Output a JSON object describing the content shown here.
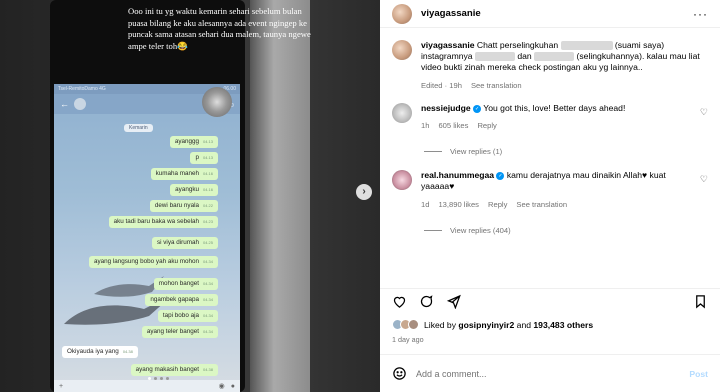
{
  "media": {
    "caption": "Ooo ini tu yg waktu kemarin sehari sebelum bulan puasa bilang ke aku alesannya ada event ngingep ke puncak sama atasan sehari dua malem, taunya ngewe ampe teler toh😂",
    "status_left": "Tsel-RemitoDamo 4G",
    "status_time": "06.00",
    "date_chip": "Kemarin",
    "messages": [
      {
        "text": "ayanggg",
        "time": "04.13",
        "side": "out"
      },
      {
        "text": "p",
        "time": "04.13",
        "side": "out"
      },
      {
        "text": "kumaha maneh",
        "time": "04.16",
        "side": "out"
      },
      {
        "text": "ayangku",
        "time": "04.16",
        "side": "out"
      },
      {
        "text": "dewi baru nyala",
        "time": "04.22",
        "side": "out"
      },
      {
        "text": "aku tadi baru baka wa sebelah",
        "time": "04.23",
        "side": "out"
      },
      {
        "text": "si viya dirumah",
        "time": "04.25",
        "side": "out"
      },
      {
        "text": "ayang langsung bobo yah aku mohon",
        "time": "04.34",
        "side": "out"
      },
      {
        "text": "mohon banget",
        "time": "04.34",
        "side": "out"
      },
      {
        "text": "ngambek gapapa",
        "time": "04.34",
        "side": "out"
      },
      {
        "text": "tapi bobo aja",
        "time": "04.34",
        "side": "out"
      },
      {
        "text": "ayang teler banget",
        "time": "04.34",
        "side": "out"
      },
      {
        "text": "Okiyauda iya yang",
        "time": "04.38",
        "side": "in"
      },
      {
        "text": "ayang makasih banget",
        "time": "04.38",
        "side": "out"
      }
    ]
  },
  "post": {
    "username": "viyagassanie",
    "caption_user": "viyagassanie",
    "caption_text": "Chatt perselingkuhan",
    "caption_suami": "(suami saya)",
    "caption_ig": "instagramnya",
    "caption_dan": "dan",
    "caption_selingkuh": "(selingkuhannya).",
    "caption_rest": "kalau mau liat video bukti zinah mereka check postingan aku yg lainnya..",
    "caption_meta_time": "Edited · 19h",
    "see_translation": "See translation",
    "comments": [
      {
        "user": "nessiejudge",
        "text": "You got this, love! Better days ahead!",
        "time": "1h",
        "likes": "605 likes",
        "reply": "Reply",
        "view_replies": "View replies (1)"
      },
      {
        "user": "real.hanummegaa",
        "text": "kamu derajatnya mau dinaikin Allah♥ kuat yaaaaa♥",
        "time": "1d",
        "likes": "13,890 likes",
        "reply": "Reply",
        "see_translation": "See translation",
        "view_replies": "View replies (404)"
      }
    ],
    "liked_by_prefix": "Liked by",
    "liked_by_user": "gosipnyinyir2",
    "liked_by_mid": "and",
    "liked_by_count": "193,483 others",
    "post_time": "1 day ago",
    "add_comment_placeholder": "Add a comment...",
    "post_button": "Post"
  }
}
